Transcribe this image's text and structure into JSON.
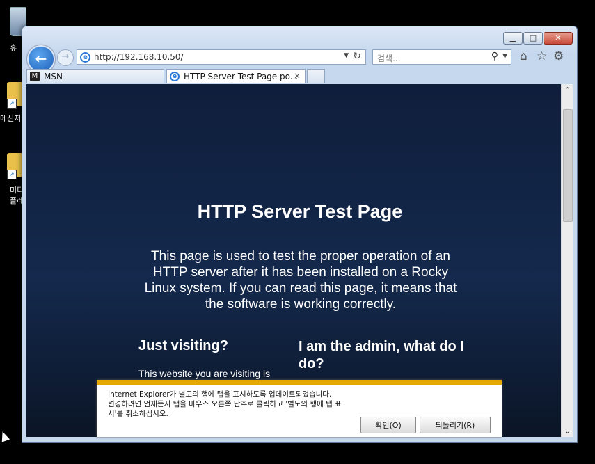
{
  "desktop": {
    "icons": [
      {
        "name": "recycle-bin",
        "label": "휴"
      },
      {
        "name": "messenger",
        "label": "메신저"
      },
      {
        "name": "media-player",
        "label": "미디\n플레"
      }
    ]
  },
  "browser": {
    "address_url": "http://192.168.10.50/",
    "search_placeholder": "검색...",
    "tabs": [
      {
        "label": "MSN"
      },
      {
        "label": "HTTP Server Test Page po..."
      }
    ],
    "close_glyph": "×"
  },
  "page": {
    "heading": "HTTP Server Test Page",
    "intro": "This page is used to test the proper operation of an HTTP server after it has been installed on a Rocky Linux system. If you can read this page, it means that the software is working correctly.",
    "col1_heading": "Just visiting?",
    "col1_text": "This website you are visiting is",
    "col2_heading": "I am the admin, what do I do?"
  },
  "notification": {
    "line1": "Internet Explorer가 별도의 행에 탭을 표시하도록 업데이트되었습니다.",
    "line2": "변경하려면 언제든지 탭을 마우스 오른쪽 단추로 클릭하고 '별도의 행에 탭 표시'를 취소하십시오.",
    "ok_label": "확인(O)",
    "revert_label": "되돌리기(R)",
    "accent_color": "#e6a800"
  },
  "colors": {
    "page_bg_top": "#0f1e3b",
    "page_bg_bottom": "#0b1526",
    "window_chrome": "#c6d8ee"
  }
}
